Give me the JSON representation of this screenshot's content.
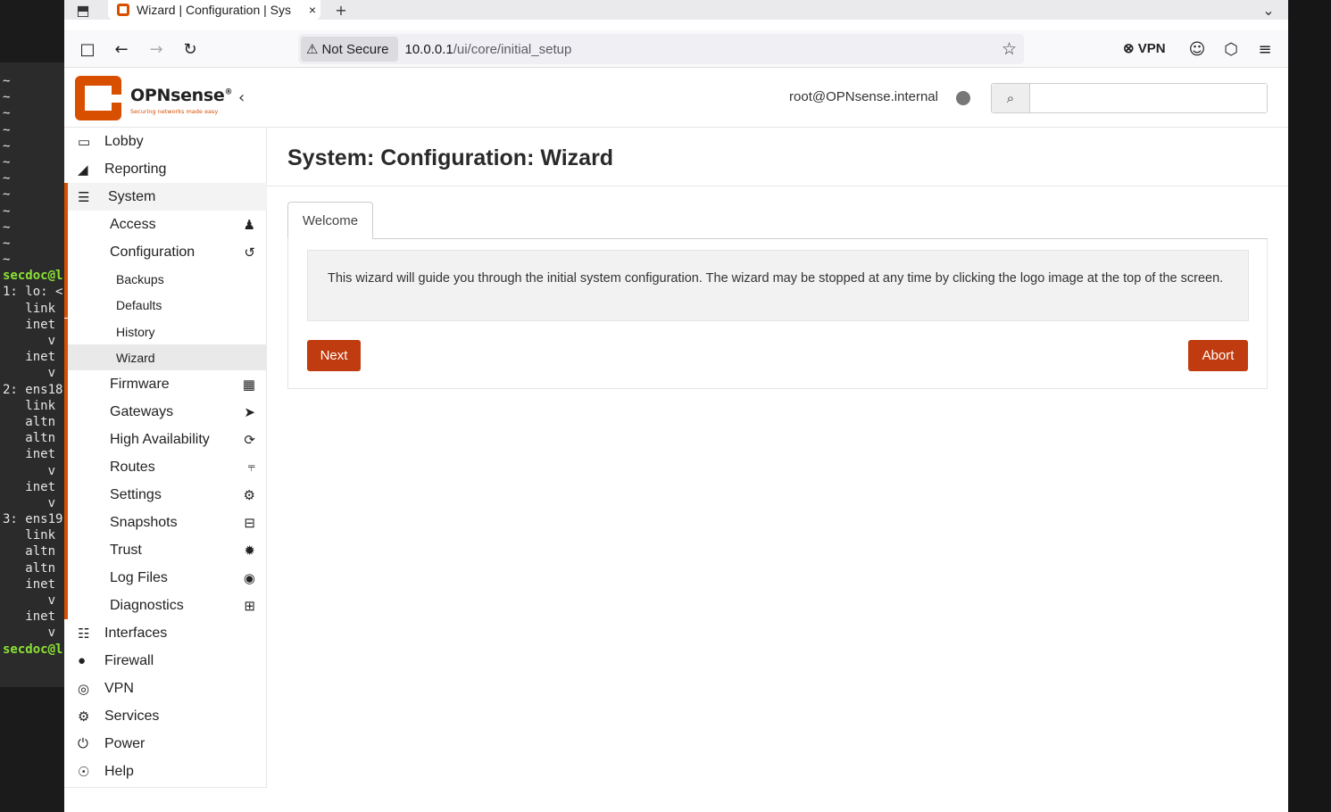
{
  "terminal": {
    "lines": [
      {
        "t": "~"
      },
      {
        "t": "~"
      },
      {
        "t": "~"
      },
      {
        "t": "~"
      },
      {
        "t": "~"
      },
      {
        "t": "~"
      },
      {
        "t": "~"
      },
      {
        "t": "~"
      },
      {
        "t": "~"
      },
      {
        "t": "~"
      },
      {
        "t": "~"
      },
      {
        "t": "~"
      },
      {
        "t": "secdoc@l",
        "cls": "g"
      },
      {
        "t": "1: lo: <"
      },
      {
        "t": "   link"
      },
      {
        "t": "   inet"
      },
      {
        "t": "      v"
      },
      {
        "t": "   inet"
      },
      {
        "t": "      v"
      },
      {
        "t": "2: ens18"
      },
      {
        "t": "   link"
      },
      {
        "t": "   altn"
      },
      {
        "t": "   altn"
      },
      {
        "t": "   inet"
      },
      {
        "t": "      v"
      },
      {
        "t": "   inet"
      },
      {
        "t": "      v"
      },
      {
        "t": "3: ens19"
      },
      {
        "t": "   link"
      },
      {
        "t": "   altn"
      },
      {
        "t": "   altn"
      },
      {
        "t": "   inet"
      },
      {
        "t": "      v"
      },
      {
        "t": "   inet"
      },
      {
        "t": "      v"
      },
      {
        "t": "secdoc@l",
        "cls": "g"
      }
    ]
  },
  "browser": {
    "tab_title": "Wizard | Configuration | Sys",
    "new_tab": "+",
    "close": "×",
    "not_secure": "Not Secure",
    "url_host": "10.0.0.1",
    "url_path": "/ui/core/initial_setup",
    "vpn_label": "VPN"
  },
  "header": {
    "logo_name": "OPNsense",
    "logo_reg": "®",
    "logo_tagline": "Securing networks made easy",
    "user": "root@OPNsense.internal",
    "search_placeholder": ""
  },
  "sidebar": {
    "lobby": "Lobby",
    "reporting": "Reporting",
    "system": "System",
    "access": "Access",
    "configuration": "Configuration",
    "backups": "Backups",
    "defaults": "Defaults",
    "history": "History",
    "wizard": "Wizard",
    "firmware": "Firmware",
    "gateways": "Gateways",
    "high_availability": "High Availability",
    "routes": "Routes",
    "settings": "Settings",
    "snapshots": "Snapshots",
    "trust": "Trust",
    "log_files": "Log Files",
    "diagnostics": "Diagnostics",
    "interfaces": "Interfaces",
    "firewall": "Firewall",
    "vpn": "VPN",
    "services": "Services",
    "power": "Power",
    "help": "Help"
  },
  "main": {
    "title": "System: Configuration: Wizard",
    "tab": "Welcome",
    "info": "This wizard will guide you through the initial system configuration. The wizard may be stopped at any time by clicking the logo image at the top of the screen.",
    "next": "Next",
    "abort": "Abort"
  },
  "colors": {
    "accent": "#d94f00",
    "button": "#c03b0f"
  }
}
